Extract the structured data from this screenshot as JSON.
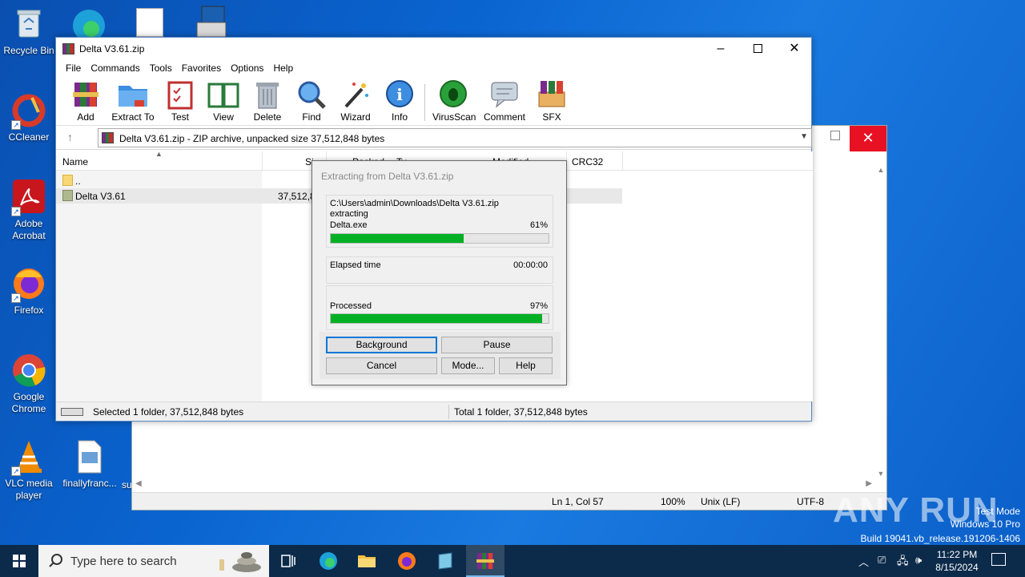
{
  "desktop": {
    "icons": [
      {
        "label": "Recycle Bin",
        "icon": "recycle-bin-icon"
      },
      {
        "label": "CCleaner",
        "icon": "ccleaner-icon"
      },
      {
        "label": "Adobe Acrobat",
        "icon": "adobe-acrobat-icon"
      },
      {
        "label": "Firefox",
        "icon": "firefox-icon"
      },
      {
        "label": "Google Chrome",
        "icon": "chrome-icon"
      },
      {
        "label": "VLC media player",
        "icon": "vlc-icon"
      },
      {
        "label": "finallyfranc...",
        "icon": "document-icon"
      },
      {
        "label": "su",
        "icon": "document-icon"
      }
    ],
    "watermark": "ANY RUN",
    "test_mode": "Test Mode",
    "edition": "Windows 10 Pro",
    "build": "Build 19041.vb_release.191206-1406"
  },
  "bg_window": {
    "status": {
      "position": "Ln 1, Col 57",
      "zoom": "100%",
      "line_ending": "Unix (LF)",
      "encoding": "UTF-8"
    }
  },
  "winrar": {
    "title": "Delta V3.61.zip",
    "menu": [
      "File",
      "Commands",
      "Tools",
      "Favorites",
      "Options",
      "Help"
    ],
    "toolbar": [
      "Add",
      "Extract To",
      "Test",
      "View",
      "Delete",
      "Find",
      "Wizard",
      "Info",
      "VirusScan",
      "Comment",
      "SFX"
    ],
    "address": "Delta V3.61.zip - ZIP archive, unpacked size 37,512,848 bytes",
    "columns": [
      "Name",
      "Si",
      "Packed",
      "Ty",
      "Modified",
      "CRC32"
    ],
    "rows": [
      {
        "name": "..",
        "size": ""
      },
      {
        "name": "Delta V3.61",
        "size": "37,512,8"
      }
    ],
    "status_left": "Selected 1 folder, 37,512,848 bytes",
    "status_right": "Total 1 folder, 37,512,848 bytes"
  },
  "dialog": {
    "title": "Extracting from Delta V3.61.zip",
    "path": "C:\\Users\\admin\\Downloads\\Delta V3.61.zip",
    "action": "extracting",
    "file": "Delta.exe",
    "file_percent": "61%",
    "file_progress": 0.61,
    "elapsed_label": "Elapsed time",
    "elapsed_value": "00:00:00",
    "processed_label": "Processed",
    "processed_percent": "97%",
    "processed_progress": 0.97,
    "buttons": {
      "background": "Background",
      "pause": "Pause",
      "cancel": "Cancel",
      "mode": "Mode...",
      "help": "Help"
    }
  },
  "taskbar": {
    "search_placeholder": "Type here to search",
    "time": "11:22 PM",
    "date": "8/15/2024"
  }
}
